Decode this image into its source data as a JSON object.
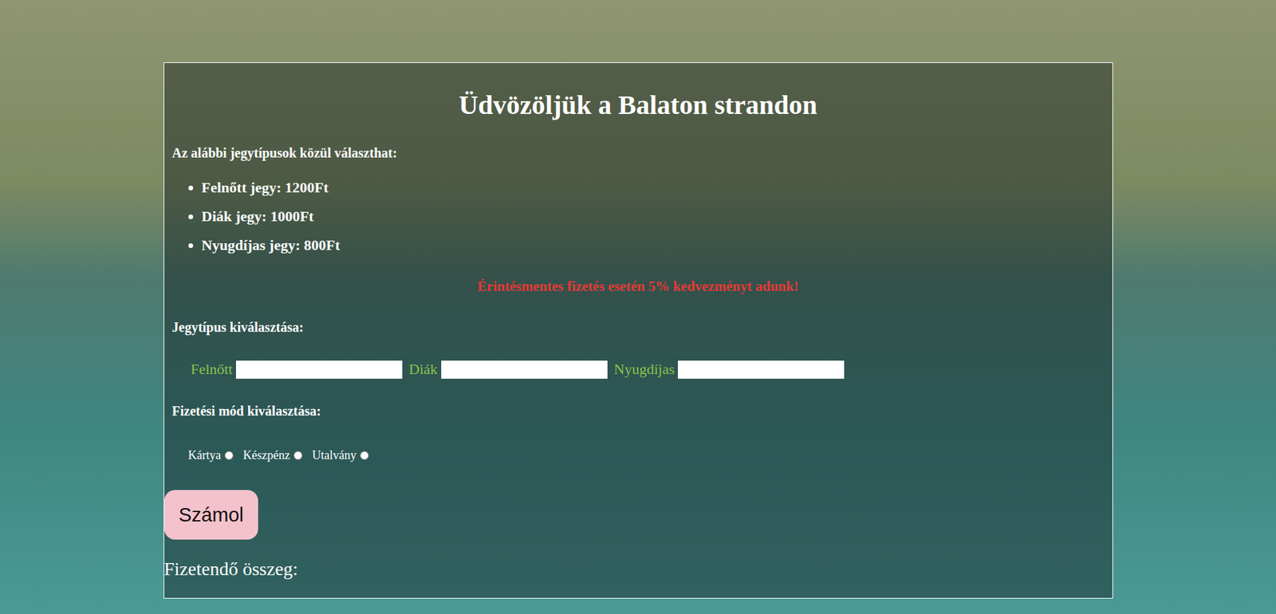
{
  "page": {
    "title": "Üdvözöljük a Balaton strandon",
    "intro": "Az alábbi jegytípusok közül választhat:",
    "tickets": [
      "Felnőtt jegy: 1200Ft",
      "Diák jegy: 1000Ft",
      "Nyugdíjas jegy: 800Ft"
    ],
    "promo": "Érintésmentes fizetés esetén 5% kedvezményt adunk!"
  },
  "ticket_section": {
    "label": "Jegytípus kiválasztása:",
    "fields": [
      {
        "label": "Felnőtt",
        "value": ""
      },
      {
        "label": "Diák",
        "value": ""
      },
      {
        "label": "Nyugdíjas",
        "value": ""
      }
    ]
  },
  "payment_section": {
    "label": "Fizetési mód kiválasztása:",
    "options": [
      {
        "label": "Kártya",
        "selected": false
      },
      {
        "label": "Készpénz",
        "selected": false
      },
      {
        "label": "Utalvány",
        "selected": false
      }
    ]
  },
  "button": "Számol",
  "total": {
    "label": "Fizetendő összeg:"
  }
}
